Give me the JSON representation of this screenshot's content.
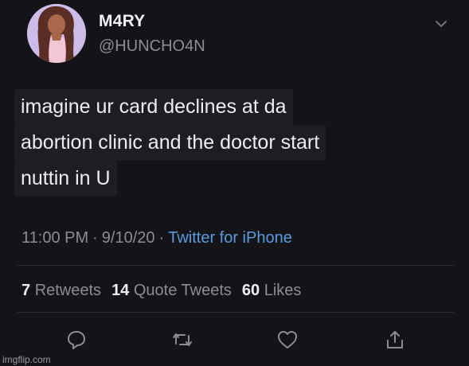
{
  "user": {
    "display_name": "M4RY",
    "handle": "@HUNCHO4N",
    "avatar_icon": "avatar-illustration"
  },
  "tweet": {
    "lines": [
      "imagine ur card declines at da",
      "abortion clinic and the doctor start",
      "nuttin in U"
    ],
    "time": "11:00 PM",
    "date": "9/10/20",
    "source": "Twitter for iPhone",
    "separator": "·"
  },
  "stats": {
    "retweets_count": "7",
    "retweets_label": "Retweets",
    "quotes_count": "14",
    "quotes_label": "Quote Tweets",
    "likes_count": "60",
    "likes_label": "Likes"
  },
  "actions": [
    "reply-icon",
    "retweet-icon",
    "like-icon",
    "share-icon"
  ],
  "watermark": "imgflip.com",
  "colors": {
    "background": "#141418",
    "text": "#eeeef2",
    "muted": "#8b8d94",
    "link": "#5a9be0"
  }
}
